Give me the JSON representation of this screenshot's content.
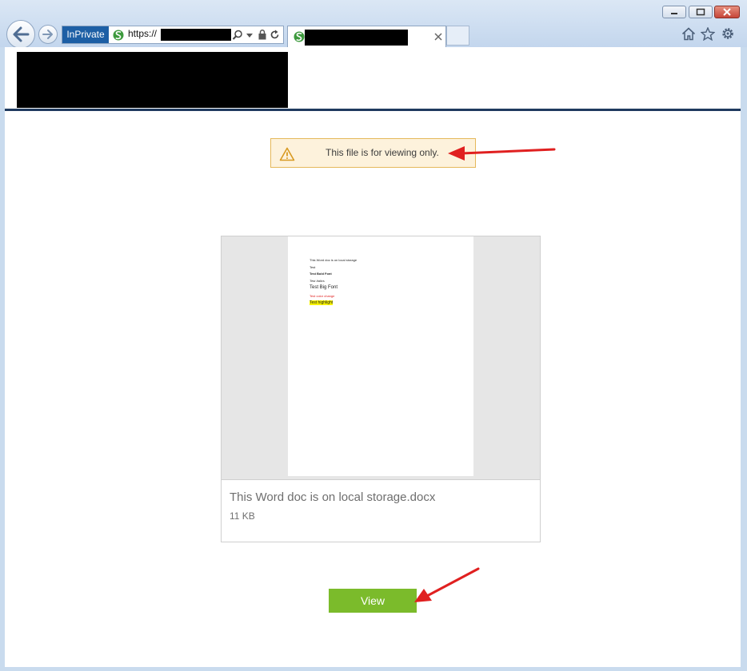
{
  "browser": {
    "inprivate_label": "InPrivate",
    "address_text": "https://",
    "icons": {
      "back": "back-arrow-icon",
      "forward": "forward-arrow-icon",
      "site": "citrix-sharefile-icon",
      "search": "search-icon",
      "dropdown": "chevron-down-icon",
      "lock": "lock-icon",
      "refresh": "refresh-icon",
      "tab_close": "close-icon",
      "home": "home-icon",
      "favorites": "star-icon",
      "settings": "gear-icon"
    },
    "window_controls": [
      "minimize",
      "maximize",
      "close"
    ]
  },
  "notice": {
    "text": "This file is for viewing only.",
    "icon": "warning-icon"
  },
  "preview": {
    "doc_lines": [
      "This Word doc is on local storage",
      "Test",
      "Test Bold Font",
      "Test Italics",
      "Test Big Font",
      "Test color change",
      "Test highlight"
    ]
  },
  "file": {
    "name": "This Word doc is on local storage.docx",
    "size": "11 KB"
  },
  "actions": {
    "view_label": "View"
  },
  "colors": {
    "header_rule": "#1f3a5f",
    "notice_bg": "#fdf2dc",
    "notice_border": "#e5b85a",
    "view_button": "#7bbb2b",
    "annotation_arrow": "#e02020"
  }
}
